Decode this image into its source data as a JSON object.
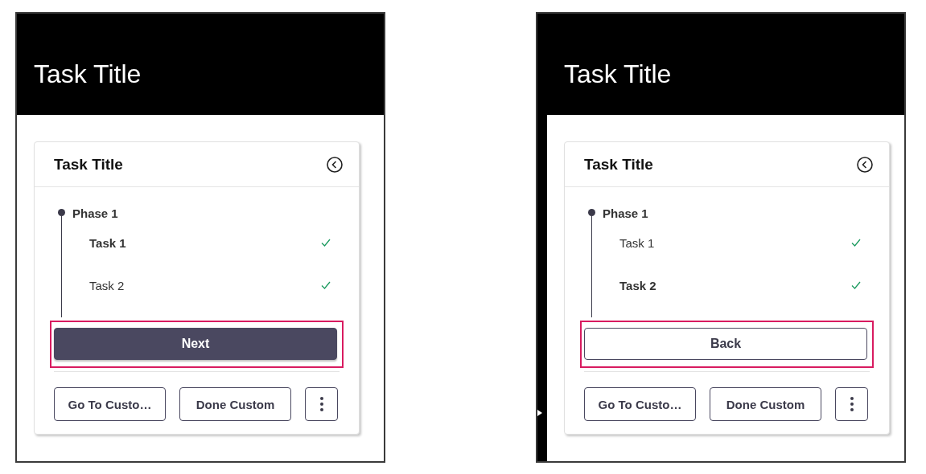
{
  "panels": [
    {
      "header_title": "Task Title",
      "side_strip": false,
      "card": {
        "title": "Task Title",
        "phase": "Phase 1",
        "tasks": [
          {
            "label": "Task 1",
            "selected": true,
            "checked": true
          },
          {
            "label": "Task 2",
            "selected": false,
            "checked": true
          }
        ],
        "primary_button": {
          "label": "Next",
          "kind": "filled",
          "highlighted": true
        },
        "actions": [
          "Go To Custo…",
          "Done Custom"
        ]
      }
    },
    {
      "header_title": "Task Title",
      "side_strip": true,
      "card": {
        "title": "Task Title",
        "phase": "Phase 1",
        "tasks": [
          {
            "label": "Task 1",
            "selected": false,
            "checked": true
          },
          {
            "label": "Task 2",
            "selected": true,
            "checked": true
          }
        ],
        "primary_button": {
          "label": "Back",
          "kind": "outline",
          "highlighted": true
        },
        "actions": [
          "Go To Custo…",
          "Done Custom"
        ]
      }
    }
  ]
}
